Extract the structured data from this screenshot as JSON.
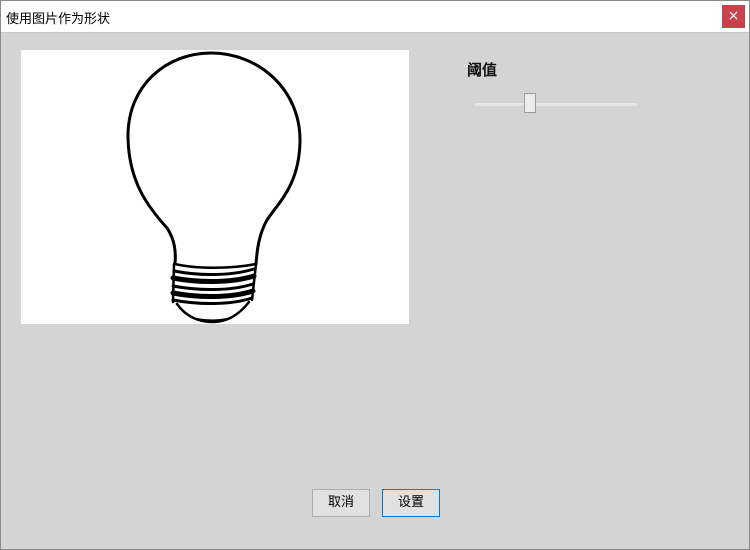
{
  "window": {
    "title": "使用图片作为形状",
    "close_glyph": "×"
  },
  "preview": {
    "image": "lightbulb-outline"
  },
  "threshold": {
    "label": "阈值",
    "value_fraction": 0.34
  },
  "buttons": {
    "cancel": "取消",
    "set": "设置"
  },
  "colors": {
    "close_button": "#c7424a",
    "dialog_background": "#d4d4d4",
    "focus_border": "#0078d7"
  }
}
